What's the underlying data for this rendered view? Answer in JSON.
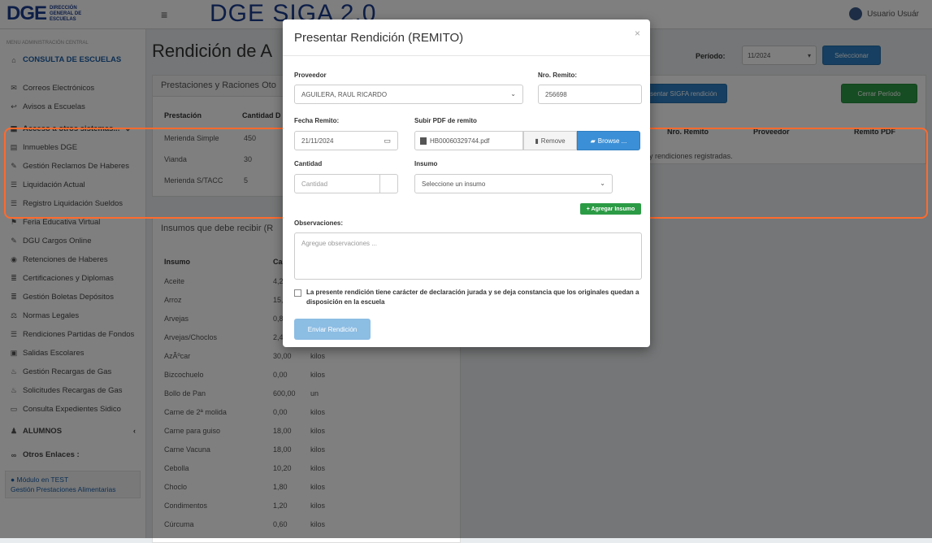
{
  "header": {
    "logo_main": "DGE",
    "logo_sub": "DIRECCIÓN GENERAL DE ESCUELAS",
    "app_title": "DGE SIGA 2.0",
    "user_name": "Usuario Usuár"
  },
  "sidebar": {
    "caption": "MENU ADMINISTRACIÓN CENTRAL",
    "items": [
      {
        "label": "CONSULTA DE ESCUELAS",
        "icon": "home-icon"
      },
      {
        "label": "Correos Electrónicos",
        "icon": "envelope-icon"
      },
      {
        "label": "Avisos a Escuelas",
        "icon": "share-icon"
      },
      {
        "label": "Acceso a otros sistemas...",
        "icon": "grid-icon"
      },
      {
        "label": "Inmuebles DGE",
        "icon": "building-icon"
      },
      {
        "label": "Gestión Reclamos De Haberes",
        "icon": "wrench-icon"
      },
      {
        "label": "Liquidación Actual",
        "icon": "list-icon"
      },
      {
        "label": "Registro Liquidación Sueldos",
        "icon": "list-icon"
      },
      {
        "label": "Feria Educativa Virtual",
        "icon": "flag-icon"
      },
      {
        "label": "DGU Cargos Online",
        "icon": "edit-icon"
      },
      {
        "label": "Retenciones de Haberes",
        "icon": "globe-icon"
      },
      {
        "label": "Certificaciones y Diplomas",
        "icon": "bars-icon"
      },
      {
        "label": "Gestión Boletas Depósitos",
        "icon": "bars-icon"
      },
      {
        "label": "Normas Legales",
        "icon": "gavel-icon"
      },
      {
        "label": "Rendiciones Partidas de Fondos",
        "icon": "list-icon"
      },
      {
        "label": "Salidas Escolares",
        "icon": "bus-icon"
      },
      {
        "label": "Gestión Recargas de Gas",
        "icon": "fire-icon"
      },
      {
        "label": "Solicitudes Recargas de Gas",
        "icon": "fire-icon"
      },
      {
        "label": "Consulta Expedientes Sidico",
        "icon": "folder-icon"
      },
      {
        "label": "ALUMNOS",
        "icon": "user-icon"
      },
      {
        "label": "Otros Enlaces :",
        "icon": "link-icon"
      }
    ],
    "test_title": "Módulo en TEST",
    "test_link": "Gestión Prestaciones Alimentarias"
  },
  "main": {
    "page_title": "Rendición de A",
    "periodo_label": "Período:",
    "periodo_value": "11/2024",
    "seleccionar": "Seleccionar",
    "presentar_btn": "Presentar SIGFA rendición",
    "cerrar_btn": "Cerrar Período",
    "panel1_title": "Prestaciones y Raciones Oto",
    "col_prestacion": "Prestación",
    "col_cantidad": "Cantidad D",
    "prestaciones": [
      {
        "name": "Merienda Simple",
        "qty": "450"
      },
      {
        "name": "Vianda",
        "qty": "30"
      },
      {
        "name": "Merienda S/TACC",
        "qty": "5"
      }
    ],
    "right_cols": [
      "Nro. Remito",
      "Proveedor",
      "Remito PDF"
    ],
    "no_rend": "No hay rendiciones registradas.",
    "panel2_title": "Insumos que debe recibir (R",
    "col_insumo": "Insumo",
    "col_cant": "Ca",
    "insumos": [
      {
        "name": "Aceite",
        "qty": "4,2",
        "unit": ""
      },
      {
        "name": "Arroz",
        "qty": "15,",
        "unit": ""
      },
      {
        "name": "Arvejas",
        "qty": "0,8",
        "unit": ""
      },
      {
        "name": "Arvejas/Choclos",
        "qty": "2,4",
        "unit": ""
      },
      {
        "name": "AzÃºcar",
        "qty": "30,00",
        "unit": "kilos"
      },
      {
        "name": "Bizcochuelo",
        "qty": "0,00",
        "unit": "kilos"
      },
      {
        "name": "Bollo de Pan",
        "qty": "600,00",
        "unit": "un"
      },
      {
        "name": "Carne de 2ª molida",
        "qty": "0,00",
        "unit": "kilos"
      },
      {
        "name": "Carne para guiso",
        "qty": "18,00",
        "unit": "kilos"
      },
      {
        "name": "Carne Vacuna",
        "qty": "18,00",
        "unit": "kilos"
      },
      {
        "name": "Cebolla",
        "qty": "10,20",
        "unit": "kilos"
      },
      {
        "name": "Choclo",
        "qty": "1,80",
        "unit": "kilos"
      },
      {
        "name": "Condimentos",
        "qty": "1,20",
        "unit": "kilos"
      },
      {
        "name": "Cúrcuma",
        "qty": "0,60",
        "unit": "kilos"
      }
    ]
  },
  "modal": {
    "title": "Presentar Rendición (REMITO)",
    "close": "×",
    "proveedor_label": "Proveedor",
    "proveedor_value": "AGUILERA, RAUL RICARDO",
    "nro_remito_label": "Nro. Remito:",
    "nro_remito_value": "256698",
    "fecha_label": "Fecha Remito:",
    "fecha_value": "21/11/2024",
    "pdf_label": "Subir PDF de remito",
    "pdf_file": "HB00060329744.pdf",
    "remove_label": "Remove",
    "browse_label": "Browse ...",
    "cantidad_label": "Cantidad",
    "cantidad_placeholder": "Cantidad",
    "insumo_label": "Insumo",
    "insumo_placeholder": "Seleccione un insumo",
    "agregar_label": "+ Agregar Insumo",
    "obs_label": "Observaciones:",
    "obs_placeholder": "Agregue observaciones ...",
    "decl_text": "La presente rendición tiene carácter de declaración jurada y se deja constancia que los originales quedan a disposición en la escuela",
    "enviar_label": "Enviar Rendición"
  },
  "colors": {
    "highlight": "#ff6a2d",
    "primary": "#2d7fc2",
    "success": "#2c9b45"
  }
}
